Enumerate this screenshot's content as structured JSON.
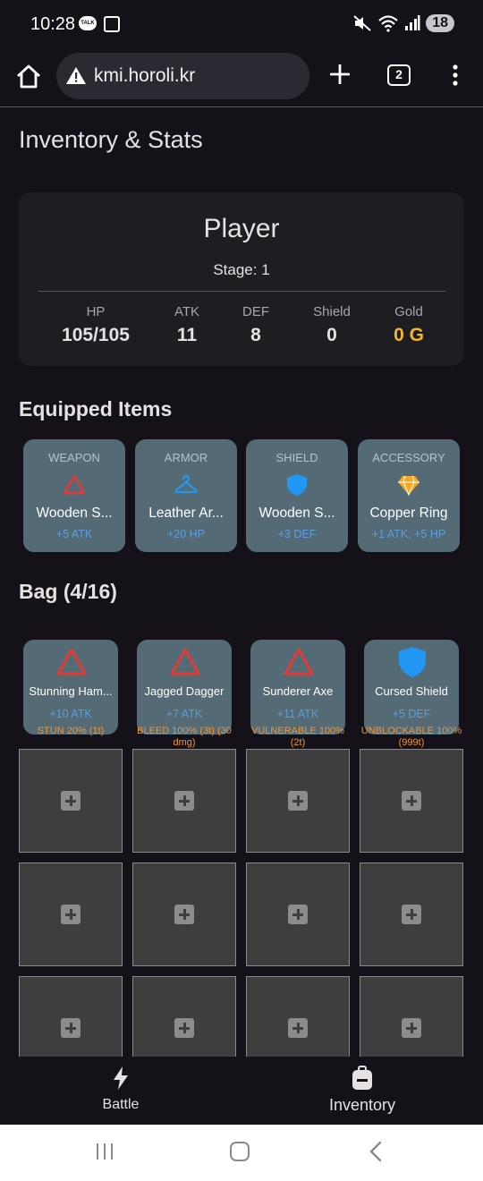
{
  "status_bar": {
    "time": "10:28",
    "talk_icon_text": "TALK",
    "battery": "18"
  },
  "browser": {
    "url": "kmi.horoli.kr",
    "tab_count": "2"
  },
  "page": {
    "title": "Inventory & Stats"
  },
  "player": {
    "name": "Player",
    "stage": "Stage: 1",
    "stats": [
      {
        "label": "HP",
        "value": "105/105"
      },
      {
        "label": "ATK",
        "value": "11"
      },
      {
        "label": "DEF",
        "value": "8"
      },
      {
        "label": "Shield",
        "value": "0"
      },
      {
        "label": "Gold",
        "value": "0 G"
      }
    ]
  },
  "equipped": {
    "title": "Equipped Items",
    "items": [
      {
        "slot": "WEAPON",
        "name": "Wooden S...",
        "bonus": "+5 ATK",
        "icon": "weapon-triangle-icon"
      },
      {
        "slot": "ARMOR",
        "name": "Leather Ar...",
        "bonus": "+20 HP",
        "icon": "hanger-icon"
      },
      {
        "slot": "SHIELD",
        "name": "Wooden S...",
        "bonus": "+3 DEF",
        "icon": "shield-icon"
      },
      {
        "slot": "ACCESSORY",
        "name": "Copper Ring",
        "bonus": "+1 ATK, +5 HP",
        "icon": "gem-icon"
      }
    ]
  },
  "bag": {
    "title": "Bag (4/16)",
    "items": [
      {
        "name": "Stunning Ham...",
        "bonus": "+10 ATK",
        "effect": "STUN 20% (1t)",
        "icon": "weapon-triangle-icon"
      },
      {
        "name": "Jagged Dagger",
        "bonus": "+7 ATK",
        "effect": "BLEED 100% (3t) (30 dmg)",
        "icon": "weapon-triangle-icon"
      },
      {
        "name": "Sunderer Axe",
        "bonus": "+11 ATK",
        "effect": "VULNERABLE 100% (2t)",
        "icon": "weapon-triangle-icon"
      },
      {
        "name": "Cursed Shield",
        "bonus": "+5 DEF",
        "effect": "UNBLOCKABLE 100% (999t)",
        "icon": "shield-icon"
      }
    ]
  },
  "bottom_nav": {
    "items": [
      {
        "label": "Battle",
        "icon": "lightning-icon"
      },
      {
        "label": "Inventory",
        "icon": "backpack-icon"
      }
    ]
  },
  "colors": {
    "background": "#141218",
    "card": "#1e1d21",
    "item_card": "#546b76",
    "gold": "#f4b528",
    "bonus_blue": "#5d9de0",
    "effect_orange": "#f19535",
    "weapon_red": "#e53935",
    "armor_blue": "#2196f3",
    "gem_orange": "#f5a623"
  }
}
